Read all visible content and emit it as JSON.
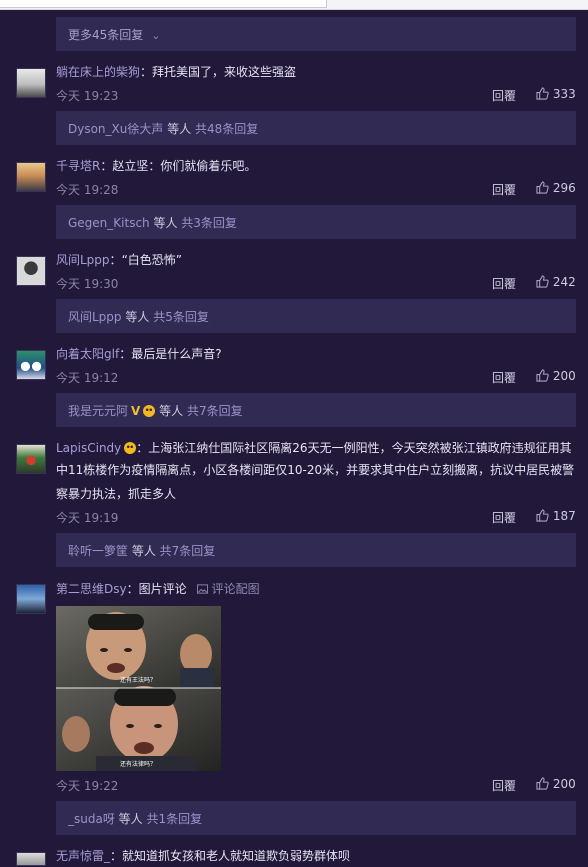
{
  "more_replies_label": "更多45条回复",
  "comments": [
    {
      "user": "躺在床上的柴狗",
      "text": "拜托美国了，来收这些强盗",
      "time": "今天 19:23",
      "reply_label": "回覆",
      "likes": "333",
      "replies": {
        "users": "Dyson_Xu徐大声",
        "mid": " 等人 ",
        "count": "共48条回复"
      }
    },
    {
      "user": "千寻塔R",
      "text": "赵立坚：你们就偷着乐吧。",
      "time": "今天 19:28",
      "reply_label": "回覆",
      "likes": "296",
      "replies": {
        "users": "Gegen_Kitsch",
        "mid": " 等人 ",
        "count": "共3条回复"
      }
    },
    {
      "user": "风间Lppp",
      "text": "“白色恐怖”",
      "time": "今天 19:30",
      "reply_label": "回覆",
      "likes": "242",
      "replies": {
        "users": "风间Lppp",
        "mid": " 等人 ",
        "count": "共5条回复"
      }
    },
    {
      "user": "向着太阳glf",
      "text": "最后是什么声音?",
      "time": "今天 19:12",
      "reply_label": "回覆",
      "likes": "200",
      "replies": {
        "users": "我是元元阿",
        "mid": " 等人 ",
        "count": "共7条回复"
      }
    },
    {
      "user": "LapisCindy",
      "text_line1": "上海张江纳仕国际社区隔离26天无一例阳性，今天突然被张江镇政府违规征用其",
      "text_line2": "中11栋楼作为疫情隔离点，小区各楼间距仅10-20米，并要求其中住户立刻搬离，抗议中居民被警",
      "text_line3": "察暴力执法，抓走多人",
      "time": "今天 19:19",
      "reply_label": "回覆",
      "likes": "187",
      "replies": {
        "users": "聆听一箩筐",
        "mid": " 等人 ",
        "count": "共7条回复"
      }
    },
    {
      "user": "第二思维Dsy",
      "text": "图片评论",
      "pic_button": "评论配图",
      "caption_top": "还有王法吗？",
      "caption_bottom": "还有法律吗？",
      "time": "今天 19:22",
      "reply_label": "回覆",
      "likes": "200",
      "replies": {
        "users": "_suda呀",
        "mid": " 等人 ",
        "count": "共1条回复"
      }
    },
    {
      "user": "无声惊雷_",
      "text": "就知道抓女孩和老人就知道欺负弱势群体呗"
    }
  ],
  "colors": {
    "background": "#22193a",
    "reply_box": "#312a52",
    "username": "#a79ed6"
  }
}
